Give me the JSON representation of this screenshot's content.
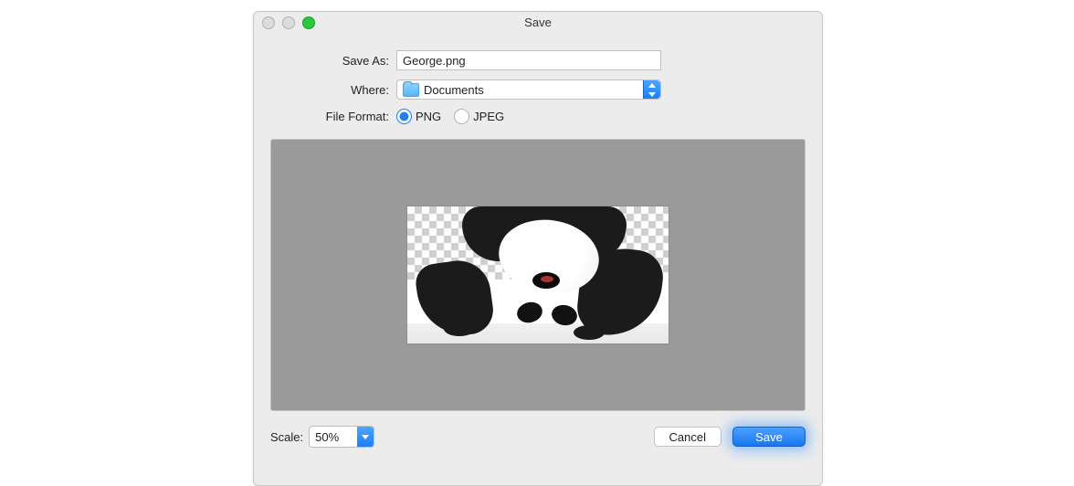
{
  "window": {
    "title": "Save"
  },
  "form": {
    "save_as_label": "Save As:",
    "save_as_value": "George.png",
    "where_label": "Where:",
    "where_value": "Documents",
    "format_label": "File Format:",
    "format_options": {
      "png": "PNG",
      "jpeg": "JPEG"
    },
    "format_selected": "png"
  },
  "preview": {
    "alt": "panda-image-preview"
  },
  "footer": {
    "scale_label": "Scale:",
    "scale_value": "50%",
    "cancel_label": "Cancel",
    "save_label": "Save"
  }
}
